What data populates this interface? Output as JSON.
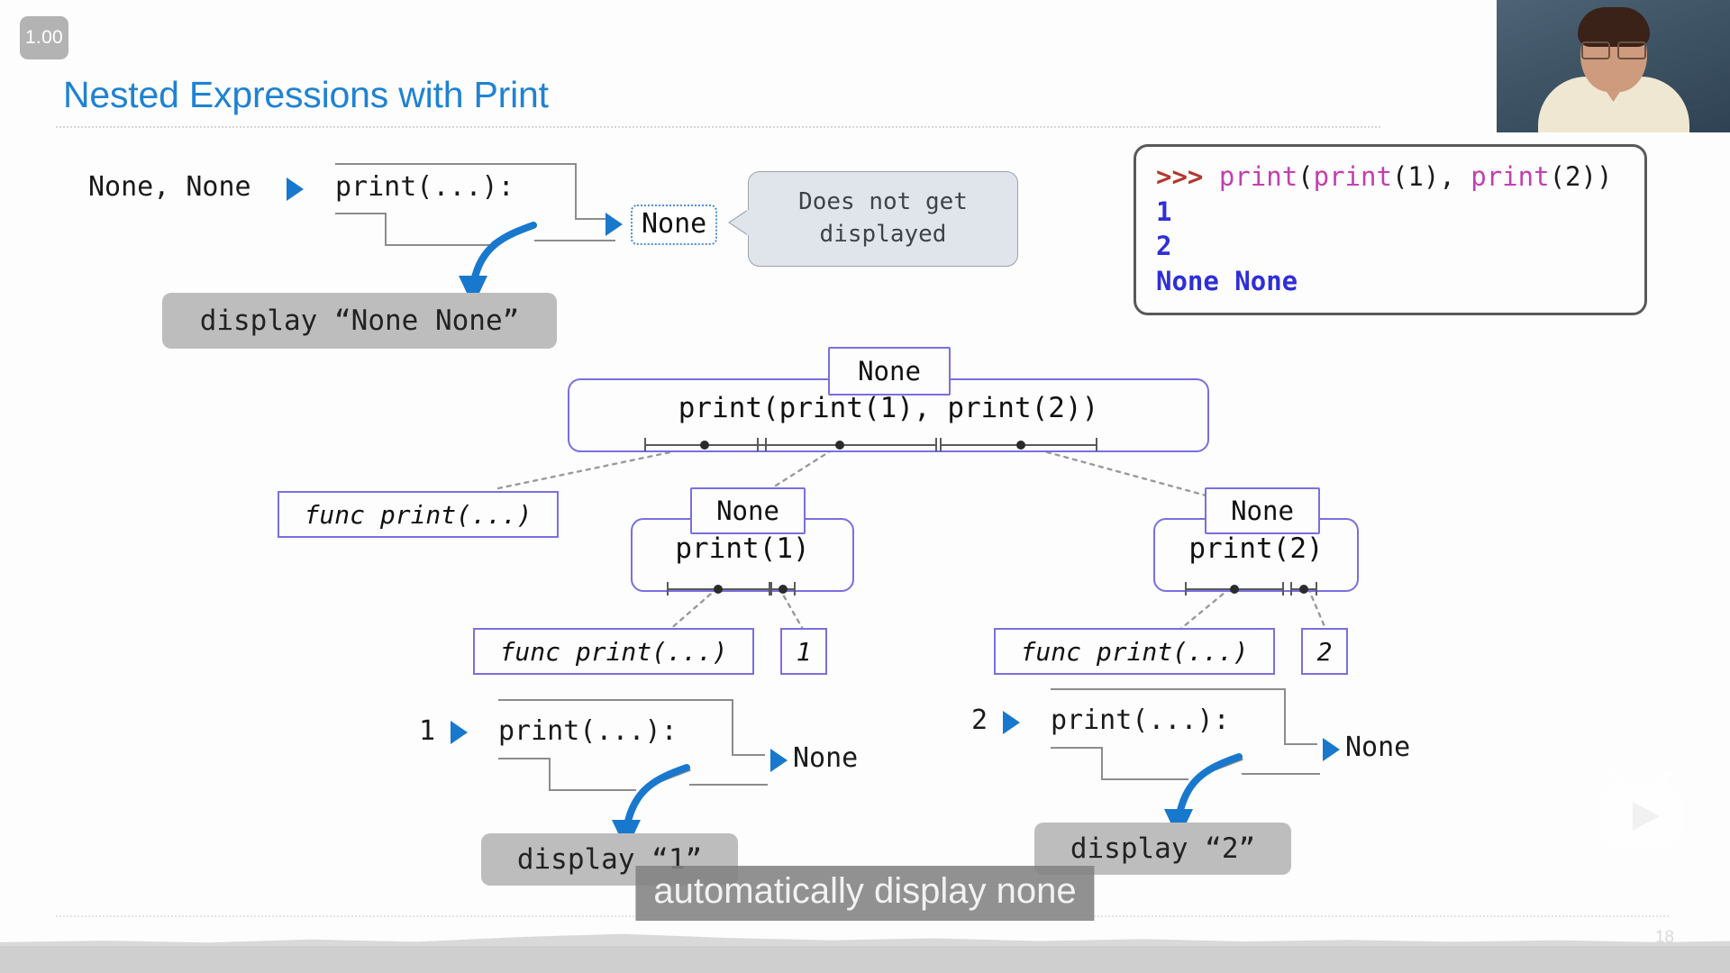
{
  "player": {
    "speed_label": "1.00",
    "caption": "automatically display none",
    "watermark_icon": "play-tv-icon"
  },
  "slide": {
    "title": "Nested Expressions with Print",
    "page_number": "18"
  },
  "top_frame": {
    "return_values": "None, None",
    "arrow_icon": "blue-triangle-icon",
    "call_label": "print(...):",
    "result_arrow_icon": "blue-triangle-icon",
    "result_value": "None",
    "note_bubble": "Does not get\ndisplayed",
    "display_pill": "display “None None”"
  },
  "repl": {
    "prompt": ">>>",
    "command_call": "print",
    "command_rest": "(",
    "command_inner1": "print",
    "command_arg1": "(1), ",
    "command_inner2": "print",
    "command_arg2": "(2))",
    "output_line1": "1",
    "output_line2": "2",
    "output_line3": "None None"
  },
  "tree": {
    "root": {
      "value": "None",
      "expression": "print(print(1), print(2))"
    },
    "root_children": [
      {
        "label": "func print(...)"
      }
    ],
    "left_branch": {
      "value": "None",
      "expression": "print(1)",
      "operator_leaf": "func print(...)",
      "operand_leaf": "1"
    },
    "right_branch": {
      "value": "None",
      "expression": "print(2)",
      "operator_leaf": "func print(...)",
      "operand_leaf": "2"
    }
  },
  "bottom_left_frame": {
    "return_values": "1",
    "arrow_icon": "blue-triangle-icon",
    "call_label": "print(...):",
    "result_arrow_icon": "blue-triangle-icon",
    "result_value": "None",
    "display_pill": "display “1”"
  },
  "bottom_right_frame": {
    "return_values": "2",
    "arrow_icon": "blue-triangle-icon",
    "call_label": "print(...):",
    "result_arrow_icon": "blue-triangle-icon",
    "result_value": "None",
    "display_pill": "display “2”"
  },
  "colors": {
    "title_blue": "#1f82d2",
    "expr_border": "#7a6fe0",
    "arrow_blue": "#1878cd",
    "repl_prompt": "#b5372f",
    "repl_call": "#c23fb0",
    "repl_output": "#2f2fd8",
    "pill_gray": "#bdbdbd"
  }
}
